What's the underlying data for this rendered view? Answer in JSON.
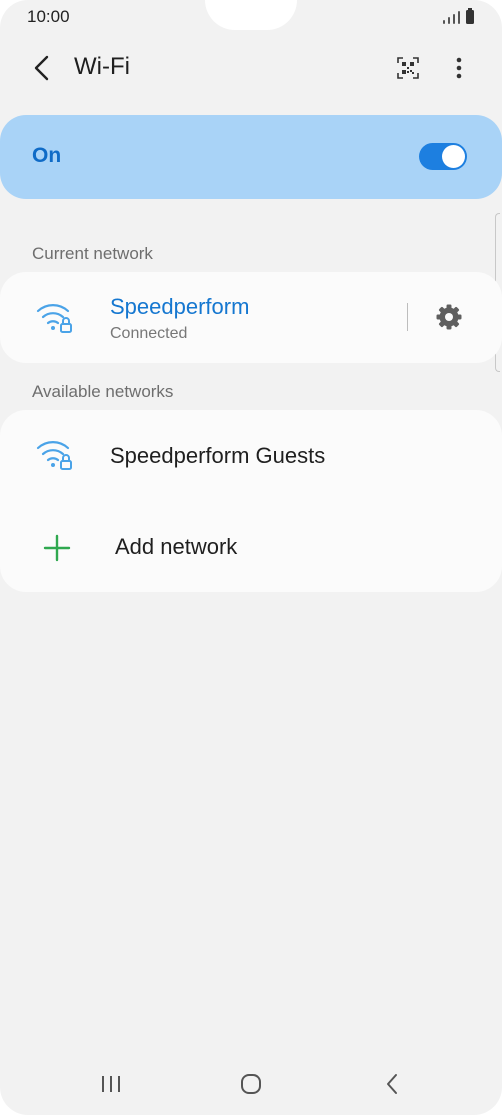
{
  "status_bar": {
    "time": "10:00"
  },
  "header": {
    "title": "Wi-Fi",
    "back_icon": "chevron-left-icon",
    "qr_icon": "qr-scan-icon",
    "more_icon": "more-vertical-icon"
  },
  "wifi_toggle": {
    "label": "On",
    "enabled": true
  },
  "current_network": {
    "section_label": "Current network",
    "name": "Speedperform",
    "status": "Connected",
    "icon": "wifi-secured-icon",
    "settings_icon": "gear-icon"
  },
  "available_networks": {
    "section_label": "Available networks",
    "items": [
      {
        "name": "Speedperform Guests",
        "icon": "wifi-secured-icon"
      }
    ],
    "add_label": "Add network",
    "add_icon": "plus-icon"
  },
  "nav_bar": {
    "recents_icon": "recents-icon",
    "home_icon": "home-icon",
    "back_icon": "back-icon"
  },
  "colors": {
    "accent": "#1d7fe0",
    "banner": "#a9d3f7",
    "on_label": "#0f6bc7",
    "wifi_icon": "#4aa3e8",
    "add_icon": "#2fa84f",
    "background": "#f2f2f2",
    "card": "#fbfbfb"
  }
}
